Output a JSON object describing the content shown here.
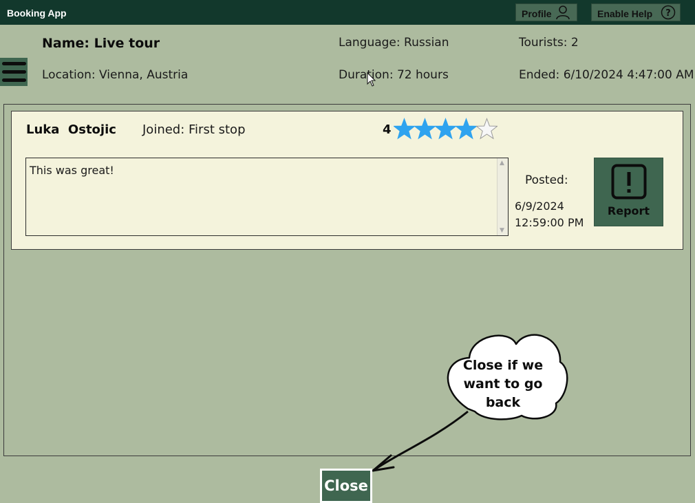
{
  "app": {
    "title": "Booking App"
  },
  "header_buttons": {
    "profile_label": "Profile",
    "help_label": "Enable Help"
  },
  "tour": {
    "name": "Name: Live tour",
    "location": "Location: Vienna, Austria",
    "language": "Language: Russian",
    "duration": "Duration: 72 hours",
    "tourists": "Tourists: 2",
    "ended": "Ended: 6/10/2024 4:47:00 AM"
  },
  "review": {
    "name": "Luka  Ostojic",
    "joined": "Joined: First stop",
    "rating_text": "4",
    "rating": 4,
    "rating_max": 5,
    "comment": "This was great!",
    "posted_label": "Posted:",
    "posted_date": "6/9/2024",
    "posted_time": "12:59:00 PM",
    "report_label": "Report"
  },
  "hint": {
    "line1": "Close if we",
    "line2": "want to go back"
  },
  "footer": {
    "close_label": "Close"
  },
  "colors": {
    "background": "#adbb9f",
    "titlebar": "#12382c",
    "button": "#3f6650",
    "card": "#f4f3dc",
    "star_filled": "#2fa3ef"
  },
  "icons": {
    "profile": "person-icon",
    "help": "question-circle-icon",
    "menu": "hamburger-icon",
    "report": "exclamation-icon",
    "star": "star-icon"
  }
}
